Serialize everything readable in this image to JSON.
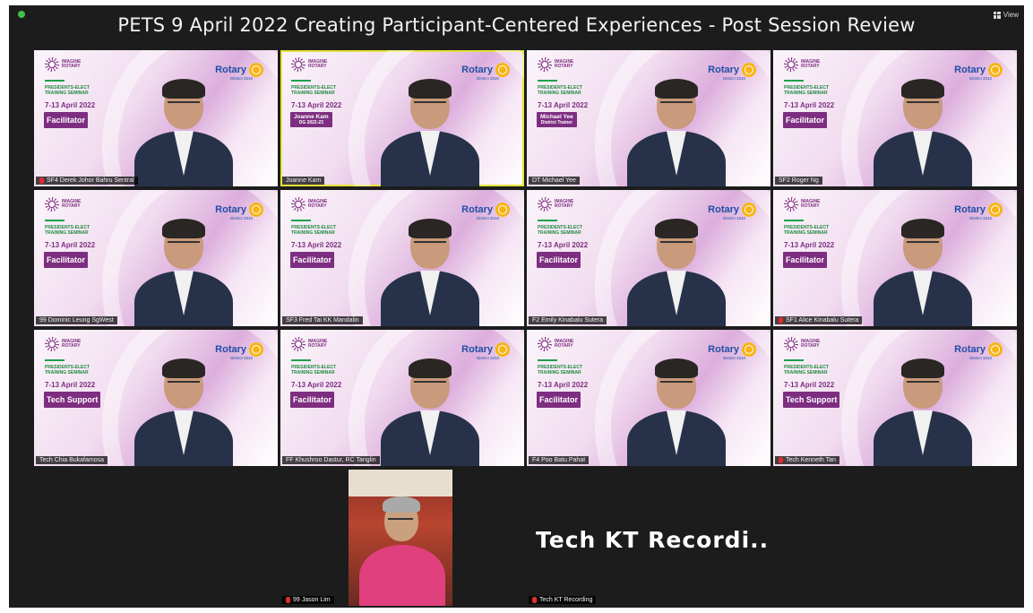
{
  "meeting": {
    "title": "PETS 9 April 2022 Creating Participant-Centered Experiences - Post Session Review",
    "view_label": "View"
  },
  "slide": {
    "brand_line1": "IMAGINE",
    "brand_line2": "ROTARY",
    "pets_line1": "PRESIDENTS-ELECT",
    "pets_line2": "TRAINING SEMINAR",
    "dates": "7-13 April 2022",
    "rotary": "Rotary",
    "district": "District 3310"
  },
  "tiles": [
    {
      "name": "SF4 Derek Johor Bahru Sentral",
      "role": "Facilitator",
      "role_sub": "",
      "active": false,
      "muted": true
    },
    {
      "name": "Joanne Kam",
      "role": "Joanne Kam",
      "role_sub": "DG 2022-23",
      "active": true,
      "muted": false
    },
    {
      "name": "DT Michael Yee",
      "role": "Michael Yee",
      "role_sub": "District Trainer",
      "active": false,
      "muted": false
    },
    {
      "name": "SF2 Roger Ng",
      "role": "Facilitator",
      "role_sub": "",
      "active": false,
      "muted": false
    },
    {
      "name": "99 Dominic Leung SgWest",
      "role": "Facilitator",
      "role_sub": "",
      "active": false,
      "muted": false
    },
    {
      "name": "SF3 Fred Tai KK Mandalin",
      "role": "Facilitator",
      "role_sub": "",
      "active": false,
      "muted": false
    },
    {
      "name": "F2 Emily Kinabalu Sutera",
      "role": "Facilitator",
      "role_sub": "",
      "active": false,
      "muted": false
    },
    {
      "name": "SF1 Alice Kinabalu Sutera",
      "role": "Facilitator",
      "role_sub": "",
      "active": false,
      "muted": true
    },
    {
      "name": "Tech Chia Bukafamosa",
      "role": "Tech Support",
      "role_sub": "",
      "active": false,
      "muted": false
    },
    {
      "name": "FF Khushroo Dastur, RC Tanglin",
      "role": "Facilitator",
      "role_sub": "",
      "active": false,
      "muted": false
    },
    {
      "name": "F4 Poo Batu Pahat",
      "role": "Facilitator",
      "role_sub": "",
      "active": false,
      "muted": false
    },
    {
      "name": "Tech Kenneth Tan",
      "role": "Tech Support",
      "role_sub": "",
      "active": false,
      "muted": true
    }
  ],
  "bottom": [
    {
      "name": "99 Jason Lim",
      "muted": true
    },
    {
      "name": "Tech KT Recording",
      "big_text": "Tech KT Recordi...",
      "muted": true
    }
  ],
  "colors": {
    "accent": "#7d2e80",
    "active_speaker": "#e6e23a",
    "muted_mic": "#e02c2c"
  }
}
